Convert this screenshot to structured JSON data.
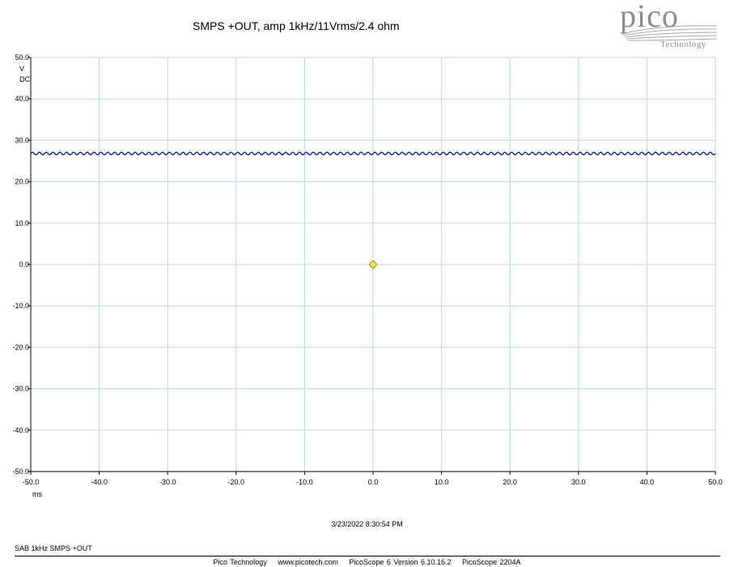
{
  "chart_data": {
    "type": "line",
    "title": "SMPS +OUT, amp 1kHz/11Vrms/2.4 ohm",
    "ylabel_unit": "V",
    "ylabel_coupling": "DC",
    "xlabel": "ms",
    "xlim": [
      -50,
      50
    ],
    "ylim": [
      -50,
      50
    ],
    "x_ticks": [
      "-50.0",
      "-40.0",
      "-30.0",
      "-20.0",
      "-10.0",
      "0.0",
      "10.0",
      "20.0",
      "30.0",
      "40.0",
      "50.0"
    ],
    "y_ticks": [
      "50.0",
      "40.0",
      "30.0",
      "20.0",
      "10.0",
      "0.0",
      "-10.0",
      "-20.0",
      "-30.0",
      "-40.0",
      "-50.0"
    ],
    "grid": true,
    "series": [
      {
        "dc_level": 26.8,
        "ripple_amplitude": 0.3,
        "ripple_period_ms": 1.0,
        "color": "#1a1aa6"
      }
    ],
    "trigger_marker": {
      "x": 0.0,
      "y": 0.0,
      "color": "#f2e33a"
    }
  },
  "timestamp": "3/23/2022 8:30:54 PM",
  "caption": "SAB 1kHz SMPS +OUT",
  "footer": {
    "company": "Pico Technology",
    "website": "www.picotech.com",
    "software": "PicoScope 6 Version 6.10.16.2",
    "device": "PicoScope 2204A"
  },
  "logo": {
    "word": "pico",
    "subtitle": "Technology"
  },
  "colors": {
    "grid": "#b4d8e6",
    "axis": "#000000",
    "trace": "#1a1aa6"
  }
}
